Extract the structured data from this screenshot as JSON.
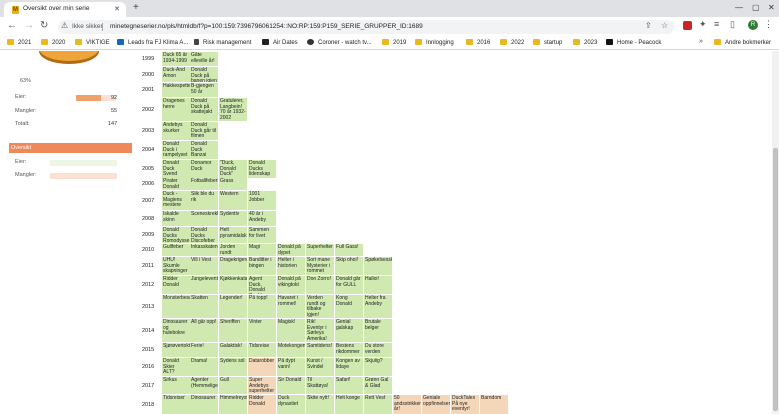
{
  "tab": {
    "title": "Oversikt over min serie",
    "favicon_letter": "M"
  },
  "address": {
    "security": "Ikke sikker",
    "url": "minetegneserier.no/pls/htmldb/f?p=100:159:7396796061254::NO:RP:159:P159_SERIE_GRUPPER_ID:1689"
  },
  "bookmarks": [
    {
      "label": "2021",
      "icon": "folder"
    },
    {
      "label": "2020",
      "icon": "folder"
    },
    {
      "label": "VIKTIGE",
      "icon": "folder"
    },
    {
      "label": "Leads fra FJ Klima A...",
      "icon": "page-icon"
    },
    {
      "label": "Risk management",
      "icon": "chevron-icon"
    },
    {
      "label": "Air Dates",
      "icon": "tv-icon"
    },
    {
      "label": "Coroner - watch tv...",
      "icon": "tv-icon"
    },
    {
      "label": "2019",
      "icon": "folder"
    },
    {
      "label": "Innlogging",
      "icon": "folder"
    },
    {
      "label": "2016",
      "icon": "folder"
    },
    {
      "label": "2022",
      "icon": "folder"
    },
    {
      "label": "startup",
      "icon": "folder"
    },
    {
      "label": "2023",
      "icon": "folder"
    },
    {
      "label": "Home - Peacock",
      "icon": "peacock-icon"
    }
  ],
  "bookmarks_more": "Andre bokmerker",
  "colors": {
    "accent": "#ee8a5a",
    "cell": "#cfe9b0",
    "cell_alt": "#f4d7b8",
    "bar_fill": "#f0a06a",
    "bar_bg": "#fbe1d4"
  },
  "stats": {
    "pie_label": "63%",
    "rows": [
      {
        "label": "Eier:",
        "value": "92",
        "fraction": 0.63
      },
      {
        "label": "Mangler:",
        "value": "55"
      },
      {
        "label": "Totalt:",
        "value": "147"
      }
    ]
  },
  "overview": {
    "header": "Oversikt",
    "owner_label": "Eier:",
    "missing_label": "Mangler:"
  },
  "years": [
    "1999",
    "2000",
    "2001",
    "2002",
    "2003",
    "2004",
    "2005",
    "2006",
    "2007",
    "2008",
    "2009",
    "2010",
    "2011",
    "2012",
    "2013",
    "2014",
    "2015",
    "2016",
    "2017",
    "2018"
  ],
  "titles": [
    [
      "Duck 65 år\n1934-1999",
      "Gåte\nelleville år!"
    ],
    [
      "Duck-And\nAmon",
      "Donald\nDuck på\nbanen igjen"
    ],
    [
      "Hakkespetten",
      "B-gjengen\n50 år"
    ],
    [
      "Dragenes\nherre",
      "Donald\nDuck på\nskattejakt",
      "Gratulerer,\nLangbein!\n70 år 1932-\n2002"
    ],
    [
      "Andebys\nskurker",
      "Donald\nDuck går til\nfilmen"
    ],
    [
      "Donald\nDuck i\nrampelyset",
      "Donald\nDuck\nBanzai"
    ],
    [
      "Donald\nDuck Svend\nog sandaler",
      "Donamor\nDuck",
      "\"Duck,\nDonald\nDuck\"",
      "Donald\nDucks\nlidenskap"
    ],
    [
      "Pirater\nDonald",
      "Fotballfeber!",
      "Grass"
    ],
    [
      "Duck -\nMagiens\nmestere",
      "Slik ble du\nrik",
      "Western",
      "1001\nJobber"
    ],
    [
      "Iskalde\nskinn",
      "Sceneskrekk",
      "Sydentiv",
      "40 år i\nAndeby"
    ],
    [
      "Donald\nDucks\nRomodysse",
      "Donald\nDucks\nDiscofeber",
      "Helt\npyramidalsk",
      "Sammen\nfor livet"
    ],
    [
      "Gullfeber",
      "Inkasskaten",
      "Jorden\nrundt",
      "Magi",
      "Donald på\ndypet",
      "Superhelter",
      "Full Gass!"
    ],
    [
      "UHU!\nSkumle\nskapninger",
      "Vill i Vest",
      "Dragekrigeren",
      "Banditter i\nbingen",
      "Helter i\nhistorien",
      "Sort mane\nMysterier i\nrommet",
      "Skip ohoi!",
      "Spøkelsesskadden"
    ],
    [
      "Ridder\nDonald",
      "Jungeleventyr",
      "Kjøkkenkatastrofer",
      "Agent Duck,\nDonald\nDuck!",
      "Donald på\nvikingtokt",
      "Don Zorro!",
      "Donald går\nfor GULL",
      "Halloi!"
    ],
    [
      "Monsterbesøk",
      "Skatten",
      "Legender!",
      "På topp!",
      "Havaret i\nrommet!",
      "Verden\nrundt og\ntilbake\nigjen!",
      "Kong\nDonald",
      "Helter fra\nAndeby"
    ],
    [
      "Dinosaurer\nog\nhulebokre",
      "All går opp!",
      "Sheriffen",
      "Vinter",
      "Magisk!",
      "Rik!\nEventyr i\nSørleys\nAmerika!",
      "Genial\ngalskap",
      "Brutale\nbelger"
    ],
    [
      "Sjørøvertokt",
      "Ferie!",
      "Galaktisk!",
      "Tidsreise",
      "Motekongen",
      "Samtidens!",
      "Bestens\nrikdommer",
      "Du store\nverden"
    ],
    [
      "Donald\nSkier\nALT?",
      "Drama!",
      "Sydens sol",
      "Datarobber",
      "På dypt\nvann!",
      "Kunst /\nSvindel",
      "Kongen av\nlidaye",
      "Skjulig?"
    ],
    [
      "Sirkus",
      "Agenter\n(Hemmelige)",
      "Gull",
      "Super\nAndebys\nsuperhelter",
      "Sir Donald",
      "Til\nSkattøya!",
      "Safari!",
      "Grønn Gal\n& Glad"
    ],
    [
      "Tidsreiser",
      "Dinosaurer",
      "Himmelreyst",
      "Ridder\nDonald",
      "Duck\ndynastiet",
      "Skite nytt!",
      "Helt konge",
      "Rett Vest",
      "50\nandsstrikker\når!",
      "Geniale\noppfinnelser",
      "DuckTales\nPå nye\neventyr!",
      "Barndom"
    ]
  ]
}
